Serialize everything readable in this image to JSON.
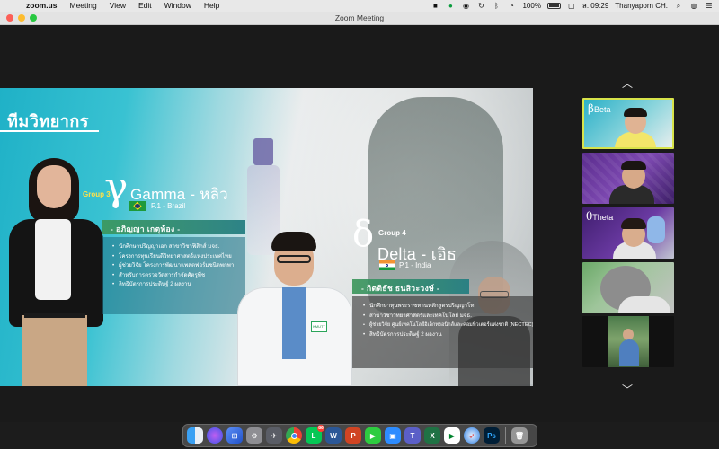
{
  "menubar": {
    "app_name": "zoom.us",
    "menus": [
      "Meeting",
      "View",
      "Edit",
      "Window",
      "Help"
    ],
    "battery": "100%",
    "date": "ส. 09:29",
    "user": "Thanyaporn CH."
  },
  "window": {
    "title": "Zoom Meeting"
  },
  "slide": {
    "title": "ทีมวิทยากร",
    "speaker1": {
      "group": "Group 3",
      "greek": "γ",
      "name": "Gamma - หลิว",
      "country": "P.1 - Brazil",
      "fullname": "- อภิญญา เกตุท้อง -",
      "bullets": [
        "นักศึกษาปริญญาเอก สาขาวิชาฟิสิกส์ มจธ.",
        "โครงการทุนเรียนดีวิทยาศาสตร์แห่งประเทศไทย",
        "ผู้ช่วยวิจัย โครงการพัฒนาแพลตฟอร์มชนิดพกพา",
        "สำหรับการตรวจวัดสารกำจัดศัตรูพืช",
        "ลิทธิบัตรการประดิษฐ์ 2 ผลงาน"
      ]
    },
    "speaker2": {
      "group": "Group 4",
      "greek": "δ",
      "name": "Delta - เอิธ",
      "country": "P.1 - India",
      "fullname": "- กิตติธัช ธนสิวะวงษ์ -",
      "bullets": [
        "นักศึกษาทุนพระราชทานหลักสูตรปริญญาโท",
        "สาขาวิชาวิทยาศาสตร์และเทคโนโลยี มจธ.",
        "ผู้ช่วยวิจัย ศูนย์เทคโนโลยีอิเล็กทรอนิกส์และคอมพิวเตอร์แห่งชาติ (NECTEC), สวทช",
        "สิทธิบัตรการประดิษฐ์ 2 ผลงาน"
      ]
    },
    "coat_badge": "KMUTT"
  },
  "participants": [
    {
      "label": "Beta",
      "greek": "β",
      "active": true
    },
    {
      "label": "",
      "greek": "",
      "active": false
    },
    {
      "label": "Theta",
      "greek": "θ",
      "active": false
    },
    {
      "label": "",
      "greek": "",
      "active": false
    },
    {
      "label": "",
      "greek": "",
      "active": false
    }
  ],
  "dock": {
    "apps": [
      "finder-icon",
      "siri-icon",
      "launchpad-icon",
      "system-preferences-icon",
      "rocket-icon",
      "chrome-icon",
      "line-icon",
      "word-icon",
      "powerpoint-icon",
      "facetime-icon",
      "zoom-icon",
      "teams-icon",
      "excel-icon",
      "meet-icon",
      "safari-icon",
      "photoshop-icon",
      "trash-icon"
    ],
    "notif_line": "86"
  },
  "colors": {
    "accent": "#d7e34a",
    "slide_teal": "#1fb1c7",
    "group_yellow": "#ffe14a"
  }
}
